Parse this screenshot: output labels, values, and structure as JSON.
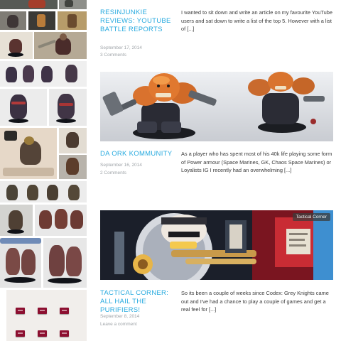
{
  "posts": [
    {
      "title": "Resinjunkie reviews: YouTube Battle Reports",
      "date": "September 17, 2014",
      "comments": "3 Comments",
      "excerpt": "I wanted to sit down and write an article on my favourite YouTube users and sat down to write a list of the top 5. However with a list of [...]"
    },
    {
      "title": "Da Ork Kommunity",
      "date": "September 16, 2014",
      "comments": "2 Comments",
      "excerpt": "As a player who has spent most of his 40k life playing some form of Power armour (Space Marines, GK, Chaos Space Marines) or Loyalists IG I recently had an overwhelming [...]"
    },
    {
      "title": "Tactical Corner: All Hail the Purifiers!",
      "date": "September 8, 2014",
      "comments": "Leave a comment",
      "excerpt": "So its been a couple of weeks since Codex: Grey Knights came out and I've had a chance to play a couple of games and get a real feel for [...]",
      "category_badge": "Tactical Corner"
    }
  ],
  "colors": {
    "link_blue": "#27aadf",
    "meta_grey": "#9fa4a8",
    "excerpt_text": "#3b3b3b"
  }
}
